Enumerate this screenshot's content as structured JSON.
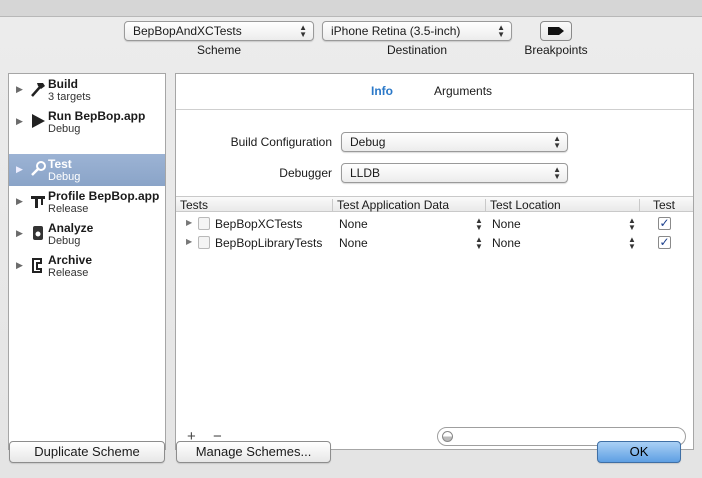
{
  "toolbar": {
    "scheme_value": "BepBopAndXCTests",
    "scheme_label": "Scheme",
    "destination_value": "iPhone Retina (3.5-inch)",
    "destination_label": "Destination",
    "breakpoints_label": "Breakpoints"
  },
  "actions": [
    {
      "name": "Build",
      "sub": "3 targets",
      "icon": "hammer-icon"
    },
    {
      "name": "Run BepBop.app",
      "sub": "Debug",
      "icon": "play-icon"
    },
    {
      "name": "Test",
      "sub": "Debug",
      "icon": "wrench-icon"
    },
    {
      "name": "Profile BepBop.app",
      "sub": "Release",
      "icon": "caliper-icon"
    },
    {
      "name": "Analyze",
      "sub": "Debug",
      "icon": "analyze-icon"
    },
    {
      "name": "Archive",
      "sub": "Release",
      "icon": "archive-icon"
    }
  ],
  "selected_action": "Test",
  "tabs": {
    "info": "Info",
    "arguments": "Arguments"
  },
  "form": {
    "build_config_label": "Build Configuration",
    "build_config_value": "Debug",
    "debugger_label": "Debugger",
    "debugger_value": "LLDB"
  },
  "table": {
    "columns": [
      "Tests",
      "Test Application Data",
      "Test Location",
      "Test"
    ],
    "rows": [
      {
        "name": "BepBopXCTests",
        "app_data": "None",
        "location": "None",
        "test": true
      },
      {
        "name": "BepBopLibraryTests",
        "app_data": "None",
        "location": "None",
        "test": true
      }
    ]
  },
  "bottom": {
    "plus": "+",
    "minus": "−",
    "filter_placeholder": ""
  },
  "buttons": {
    "duplicate": "Duplicate Scheme",
    "manage": "Manage Schemes...",
    "ok": "OK"
  },
  "colors": {
    "accent_tab": "#2a78c8",
    "selection": "#8aa4c8",
    "ok_button": "#5e9fe3"
  }
}
